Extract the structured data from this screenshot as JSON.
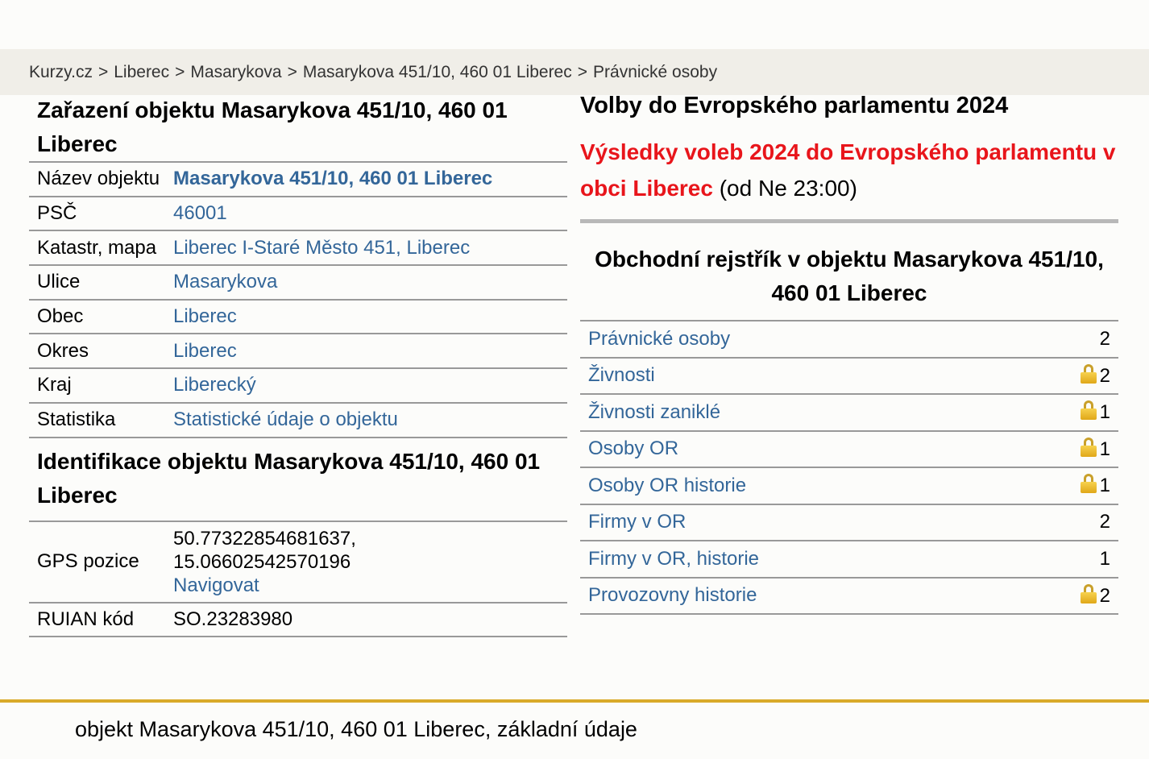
{
  "breadcrumb": [
    {
      "label": "Kurzy.cz",
      "link": true
    },
    {
      "label": "Liberec",
      "link": true
    },
    {
      "label": "Masarykova",
      "link": true
    },
    {
      "label": "Masarykova 451/10, 460 01 Liberec",
      "link": true
    },
    {
      "label": "Právnické osoby",
      "link": false
    }
  ],
  "classification": {
    "title": "Zařazení objektu Masarykova 451/10, 460 01 Liberec",
    "rows": [
      {
        "key": "Název objektu",
        "value": "Masarykova 451/10, 460 01 Liberec",
        "link": true,
        "bold": true
      },
      {
        "key": "PSČ",
        "value": "46001",
        "link": true
      },
      {
        "key": "Katastr, mapa",
        "value": "Liberec I-Staré Město 451, Liberec",
        "link": true
      },
      {
        "key": "Ulice",
        "value": "Masarykova",
        "link": true
      },
      {
        "key": "Obec",
        "value": "Liberec",
        "link": true
      },
      {
        "key": "Okres",
        "value": "Liberec",
        "link": true
      },
      {
        "key": "Kraj",
        "value": "Liberecký",
        "link": true
      },
      {
        "key": "Statistika",
        "value": "Statistické údaje o objektu",
        "link": true
      }
    ]
  },
  "identification": {
    "title": "Identifikace objektu Masarykova 451/10, 460 01 Liberec",
    "gps_label": "GPS pozice",
    "gps_line1": "50.77322854681637,",
    "gps_line2": "15.06602542570196",
    "navigate": "Navigovat",
    "ruian_label": "RUIAN kód",
    "ruian_value": "SO.23283980"
  },
  "election": {
    "title": "Volby do Evropského parlamentu 2024",
    "link_text": "Výsledky voleb 2024 do Evropského parlamentu v obci Liberec",
    "suffix": "(od Ne 23:00)"
  },
  "registry": {
    "title": "Obchodní rejstřík v objektu Masarykova 451/10, 460 01 Liberec",
    "rows": [
      {
        "label": "Právnické osoby",
        "count": "2",
        "locked": false
      },
      {
        "label": "Živnosti",
        "count": "2",
        "locked": true
      },
      {
        "label": "Živnosti zaniklé",
        "count": "1",
        "locked": true
      },
      {
        "label": "Osoby OR",
        "count": "1",
        "locked": true
      },
      {
        "label": "Osoby OR historie",
        "count": "1",
        "locked": true
      },
      {
        "label": "Firmy v OR",
        "count": "2",
        "locked": false
      },
      {
        "label": "Firmy v OR, historie",
        "count": "1",
        "locked": false
      },
      {
        "label": "Provozovny historie",
        "count": "2",
        "locked": true
      }
    ]
  },
  "footer": {
    "text": "objekt Masarykova 451/10, 460 01 Liberec, základní údaje"
  },
  "colors": {
    "link": "#336699",
    "red": "#e8151b",
    "footer_line": "#d9aa2a",
    "breadcrumb_bg": "#f0eee8"
  }
}
